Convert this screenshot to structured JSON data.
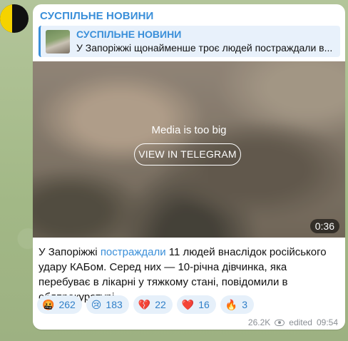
{
  "channel": {
    "name": "СУСПІЛЬНЕ НОВИНИ"
  },
  "reply": {
    "title": "СУСПІЛЬНЕ НОВИНИ",
    "text": "У Запоріжжі щонайменше троє людей постраждали в..."
  },
  "media": {
    "status_text": "Media is too big",
    "button_label": "VIEW IN TELEGRAM",
    "duration": "0:36"
  },
  "message": {
    "before_link": "У Запоріжжі ",
    "link_text": "постраждали",
    "after_link": " 11 людей внаслідок російського удару КАБом. Серед них — 10-річна дівчинка, яка перебуває в лікарні у тяжкому стані, повідомили в облпрокуратурі."
  },
  "reactions": [
    {
      "emoji": "🤬",
      "count": "262"
    },
    {
      "emoji": "😢",
      "count": "183"
    },
    {
      "emoji": "💔",
      "count": "22"
    },
    {
      "emoji": "❤️",
      "count": "16"
    },
    {
      "emoji": "🔥",
      "count": "3"
    }
  ],
  "footer": {
    "views": "26.2K",
    "edited_label": "edited",
    "time": "09:54"
  }
}
